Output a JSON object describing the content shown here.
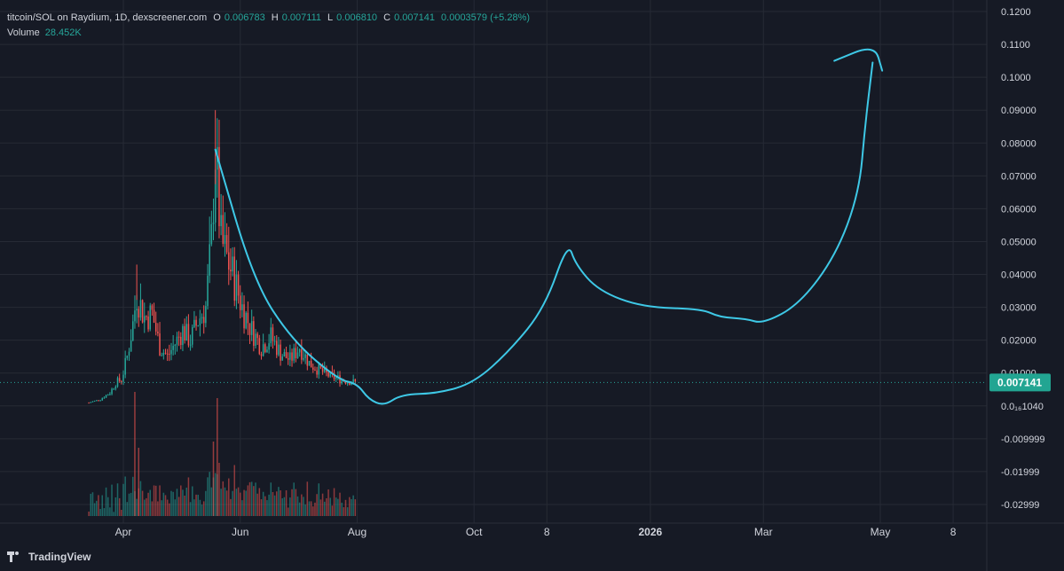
{
  "header": {
    "symbol": "titcoin/SOL on Raydium, 1D, dexscreener.com",
    "o_label": "O",
    "o_value": "0.006783",
    "h_label": "H",
    "h_value": "0.007111",
    "l_label": "L",
    "l_value": "0.006810",
    "c_label": "C",
    "c_value": "0.007141",
    "change": "0.0003579 (+5.28%)",
    "volume_label": "Volume",
    "volume_value": "28.452K"
  },
  "branding": {
    "label": "TradingView",
    "icon": "tradingview-logo-icon"
  },
  "colors": {
    "background": "#161a25",
    "grid": "#262a35",
    "text": "#d1d4dc",
    "up": "#26a69a",
    "down": "#ef5350",
    "drawing": "#3ec8e6",
    "price_badge": "#22a592"
  },
  "chart_data": {
    "type": "candlestick",
    "y_axis": {
      "ticks": [
        "0.1200",
        "0.1100",
        "0.1000",
        "0.09000",
        "0.08000",
        "0.07000",
        "0.06000",
        "0.05000",
        "0.04000",
        "0.03000",
        "0.02000",
        "0.01000",
        "0.0₁₆1040",
        "-0.009999",
        "-0.01999",
        "-0.02999"
      ],
      "tick_values": [
        0.12,
        0.11,
        0.1,
        0.09,
        0.08,
        0.07,
        0.06,
        0.05,
        0.04,
        0.03,
        0.02,
        0.01,
        0.0,
        -0.01,
        -0.02,
        -0.03
      ],
      "range": [
        -0.033,
        0.1225
      ],
      "current_price_label": "0.007141",
      "current_price": 0.007141
    },
    "x_axis": {
      "ticks": [
        "Apr",
        "Jun",
        "Aug",
        "Oct",
        "8",
        "2026",
        "Mar",
        "May",
        "8"
      ],
      "bold_ticks": [
        "2026"
      ],
      "tick_dates": [
        "2025-04-01",
        "2025-06-01",
        "2025-08-01",
        "2025-10-01",
        "2025-11-08",
        "2026-01-01",
        "2026-03-01",
        "2026-05-01",
        "2026-06-08"
      ]
    },
    "price_path": [
      {
        "date": "2025-03-14",
        "close": 0.001
      },
      {
        "date": "2025-03-20",
        "close": 0.002
      },
      {
        "date": "2025-03-25",
        "close": 0.004
      },
      {
        "date": "2025-03-28",
        "close": 0.007
      },
      {
        "date": "2025-03-31",
        "close": 0.008
      },
      {
        "date": "2025-04-03",
        "close": 0.015
      },
      {
        "date": "2025-04-06",
        "close": 0.025
      },
      {
        "date": "2025-04-08",
        "close": 0.034
      },
      {
        "date": "2025-04-12",
        "close": 0.027
      },
      {
        "date": "2025-04-16",
        "close": 0.028
      },
      {
        "date": "2025-04-20",
        "close": 0.018
      },
      {
        "date": "2025-04-24",
        "close": 0.015
      },
      {
        "date": "2025-04-28",
        "close": 0.019
      },
      {
        "date": "2025-05-02",
        "close": 0.023
      },
      {
        "date": "2025-05-06",
        "close": 0.02
      },
      {
        "date": "2025-05-10",
        "close": 0.026
      },
      {
        "date": "2025-05-14",
        "close": 0.03
      },
      {
        "date": "2025-05-17",
        "close": 0.05
      },
      {
        "date": "2025-05-19",
        "close": 0.078
      },
      {
        "date": "2025-05-22",
        "close": 0.05
      },
      {
        "date": "2025-05-25",
        "close": 0.045
      },
      {
        "date": "2025-05-28",
        "close": 0.04
      },
      {
        "date": "2025-06-02",
        "close": 0.03
      },
      {
        "date": "2025-06-07",
        "close": 0.023
      },
      {
        "date": "2025-06-12",
        "close": 0.018
      },
      {
        "date": "2025-06-17",
        "close": 0.021
      },
      {
        "date": "2025-06-22",
        "close": 0.016
      },
      {
        "date": "2025-06-27",
        "close": 0.014
      },
      {
        "date": "2025-07-02",
        "close": 0.018
      },
      {
        "date": "2025-07-07",
        "close": 0.013
      },
      {
        "date": "2025-07-12",
        "close": 0.011
      },
      {
        "date": "2025-07-18",
        "close": 0.009
      },
      {
        "date": "2025-07-24",
        "close": 0.008
      },
      {
        "date": "2025-07-31",
        "close": 0.0071
      }
    ],
    "highs": [
      {
        "date": "2025-04-08",
        "high": 0.043
      },
      {
        "date": "2025-05-19",
        "high": 0.09
      },
      {
        "date": "2025-05-21",
        "high": 0.068
      }
    ],
    "volume_bars": [
      {
        "date": "2025-04-07",
        "value": 1.0
      },
      {
        "date": "2025-05-20",
        "value": 0.95
      },
      {
        "date": "2025-05-18",
        "value": 0.6
      },
      {
        "date": "2025-04-09",
        "value": 0.55
      }
    ],
    "drawing": {
      "color": "#3ec8e6",
      "description_points": [
        {
          "date": "2025-05-19",
          "value": 0.078
        },
        {
          "date": "2025-06-08",
          "value": 0.038
        },
        {
          "date": "2025-06-28",
          "value": 0.02
        },
        {
          "date": "2025-07-22",
          "value": 0.008
        },
        {
          "date": "2025-08-01",
          "value": 0.0068
        },
        {
          "date": "2025-08-07",
          "value": 0.002
        },
        {
          "date": "2025-08-15",
          "value": 0.0
        },
        {
          "date": "2025-08-24",
          "value": 0.0035
        },
        {
          "date": "2025-09-12",
          "value": 0.0038
        },
        {
          "date": "2025-10-01",
          "value": 0.007
        },
        {
          "date": "2025-10-20",
          "value": 0.017
        },
        {
          "date": "2025-11-07",
          "value": 0.03
        },
        {
          "date": "2025-11-19",
          "value": 0.05
        },
        {
          "date": "2025-11-23",
          "value": 0.043
        },
        {
          "date": "2025-12-05",
          "value": 0.035
        },
        {
          "date": "2025-12-28",
          "value": 0.03
        },
        {
          "date": "2026-01-28",
          "value": 0.0295
        },
        {
          "date": "2026-02-06",
          "value": 0.027
        },
        {
          "date": "2026-02-20",
          "value": 0.0265
        },
        {
          "date": "2026-03-01",
          "value": 0.025
        },
        {
          "date": "2026-03-20",
          "value": 0.031
        },
        {
          "date": "2026-04-08",
          "value": 0.046
        },
        {
          "date": "2026-04-20",
          "value": 0.065
        },
        {
          "date": "2026-04-23",
          "value": 0.085
        },
        {
          "date": "2026-04-27",
          "value": 0.1045
        }
      ],
      "hook_points": [
        {
          "date": "2026-04-07",
          "value": 0.105
        },
        {
          "date": "2026-04-28",
          "value": 0.11
        },
        {
          "date": "2026-05-02",
          "value": 0.102
        }
      ]
    }
  }
}
